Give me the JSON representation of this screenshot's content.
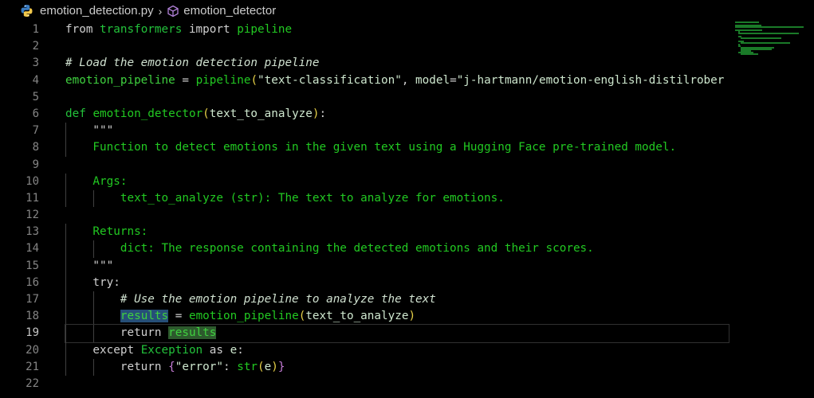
{
  "breadcrumb": {
    "file": "emotion_detection.py",
    "separator": "›",
    "symbol": "emotion_detector"
  },
  "current_line": 19,
  "lines": [
    {
      "n": "1",
      "tokens": [
        [
          "g-kw",
          "from "
        ],
        [
          "g-mod",
          "transformers"
        ],
        [
          "g-kw",
          " import "
        ],
        [
          "g-fn",
          "pipeline"
        ]
      ]
    },
    {
      "n": "2",
      "tokens": []
    },
    {
      "n": "3",
      "tokens": [
        [
          "g-cmt",
          "# Load the emotion detection pipeline"
        ]
      ]
    },
    {
      "n": "4",
      "tokens": [
        [
          "g-var",
          "emotion_pipeline"
        ],
        [
          "g-kw",
          " = "
        ],
        [
          "g-fn",
          "pipeline"
        ],
        [
          "g-paren",
          "("
        ],
        [
          "g-str",
          "\"text-classification\""
        ],
        [
          "g-kw",
          ", "
        ],
        [
          "g-param",
          "model"
        ],
        [
          "g-kw",
          "="
        ],
        [
          "g-str",
          "\"j-hartmann/emotion-english-distilrober"
        ]
      ]
    },
    {
      "n": "5",
      "tokens": []
    },
    {
      "n": "6",
      "tokens": [
        [
          "g-mod",
          "def "
        ],
        [
          "g-fn",
          "emotion_detector"
        ],
        [
          "g-paren",
          "("
        ],
        [
          "g-param",
          "text_to_analyze"
        ],
        [
          "g-paren",
          ")"
        ],
        [
          "g-kw",
          ":"
        ]
      ]
    },
    {
      "n": "7",
      "tokens": [
        [
          "g-kw",
          "    \"\"\""
        ]
      ]
    },
    {
      "n": "8",
      "tokens": [
        [
          "g-fn",
          "    Function to detect emotions in the given text using a Hugging Face pre-trained model."
        ]
      ]
    },
    {
      "n": "9",
      "tokens": []
    },
    {
      "n": "10",
      "tokens": [
        [
          "g-fn",
          "    Args:"
        ]
      ]
    },
    {
      "n": "11",
      "tokens": [
        [
          "g-fn",
          "        text_to_analyze (str): The text to analyze for emotions."
        ]
      ]
    },
    {
      "n": "12",
      "tokens": []
    },
    {
      "n": "13",
      "tokens": [
        [
          "g-fn",
          "    Returns:"
        ]
      ]
    },
    {
      "n": "14",
      "tokens": [
        [
          "g-fn",
          "        dict: The response containing the detected emotions and their scores."
        ]
      ]
    },
    {
      "n": "15",
      "tokens": [
        [
          "g-kw",
          "    \"\"\""
        ]
      ]
    },
    {
      "n": "16",
      "tokens": [
        [
          "g-kw",
          "    try:"
        ]
      ]
    },
    {
      "n": "17",
      "tokens": [
        [
          "g-cmt",
          "        # Use the emotion pipeline to analyze the text"
        ]
      ]
    },
    {
      "n": "18",
      "tokens": [
        [
          "g-kw",
          "        "
        ],
        [
          "g-var hl-sel",
          "results"
        ],
        [
          "g-kw",
          " = "
        ],
        [
          "g-fn",
          "emotion_pipeline"
        ],
        [
          "g-paren",
          "("
        ],
        [
          "g-param",
          "text_to_analyze"
        ],
        [
          "g-paren",
          ")"
        ]
      ]
    },
    {
      "n": "19",
      "tokens": [
        [
          "g-kw",
          "        return "
        ],
        [
          "g-var hl-ref",
          "results"
        ]
      ]
    },
    {
      "n": "20",
      "tokens": [
        [
          "g-kw",
          "    except "
        ],
        [
          "g-mod",
          "Exception"
        ],
        [
          "g-kw",
          " as "
        ],
        [
          "g-param",
          "e"
        ],
        [
          "g-kw",
          ":"
        ]
      ]
    },
    {
      "n": "21",
      "tokens": [
        [
          "g-kw",
          "        return "
        ],
        [
          "g-paren2",
          "{"
        ],
        [
          "g-str",
          "\"error\""
        ],
        [
          "g-kw",
          ": "
        ],
        [
          "g-fn",
          "str"
        ],
        [
          "g-paren",
          "("
        ],
        [
          "g-param",
          "e"
        ],
        [
          "g-paren",
          ")"
        ],
        [
          "g-paren2",
          "}"
        ]
      ]
    },
    {
      "n": "22",
      "tokens": []
    }
  ],
  "colors": {
    "background": "#000000",
    "line_number": "#858585",
    "keyword": "#cfcfcf",
    "green": "#22c922"
  }
}
